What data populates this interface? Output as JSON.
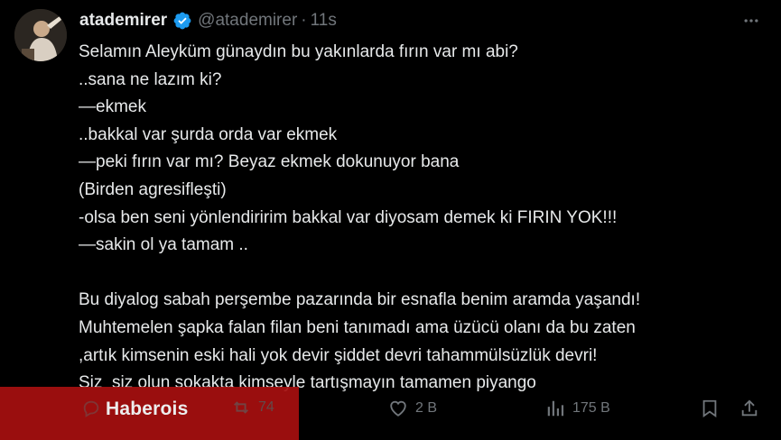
{
  "post": {
    "display_name": "atademirer",
    "handle": "@atademirer",
    "separator": "·",
    "time": "11s",
    "lines": [
      "Selamın Aleyküm günaydın bu yakınlarda fırın var mı abi?",
      "..sana ne lazım ki?",
      "—ekmek",
      "..bakkal var şurda orda var ekmek",
      "—peki fırın var mı? Beyaz ekmek dokunuyor bana",
      "(Birden agresifleşti)",
      "-olsa ben seni yönlendiririm bakkal var diyosam demek ki FIRIN YOK!!!",
      "—sakin ol ya tamam ..",
      "",
      "Bu diyalog sabah perşembe pazarında bir esnafla benim aramda yaşandı!",
      "Muhtemelen şapka falan filan beni tanımadı ama üzücü olanı da bu zaten",
      ",artık kimsenin eski hali yok devir şiddet devri tahammülsüzlük devri!",
      "Siz  siz olun sokakta kimseyle tartışmayın tamamen piyango"
    ]
  },
  "actions": {
    "retweets": "74",
    "likes": "2 B",
    "views": "175 B"
  },
  "watermark": {
    "text": "Haberois"
  },
  "colors": {
    "background": "#000000",
    "text": "#e7e9ea",
    "muted": "#71767b",
    "verified": "#1d9bf0",
    "watermark_bg": "#a61010"
  }
}
